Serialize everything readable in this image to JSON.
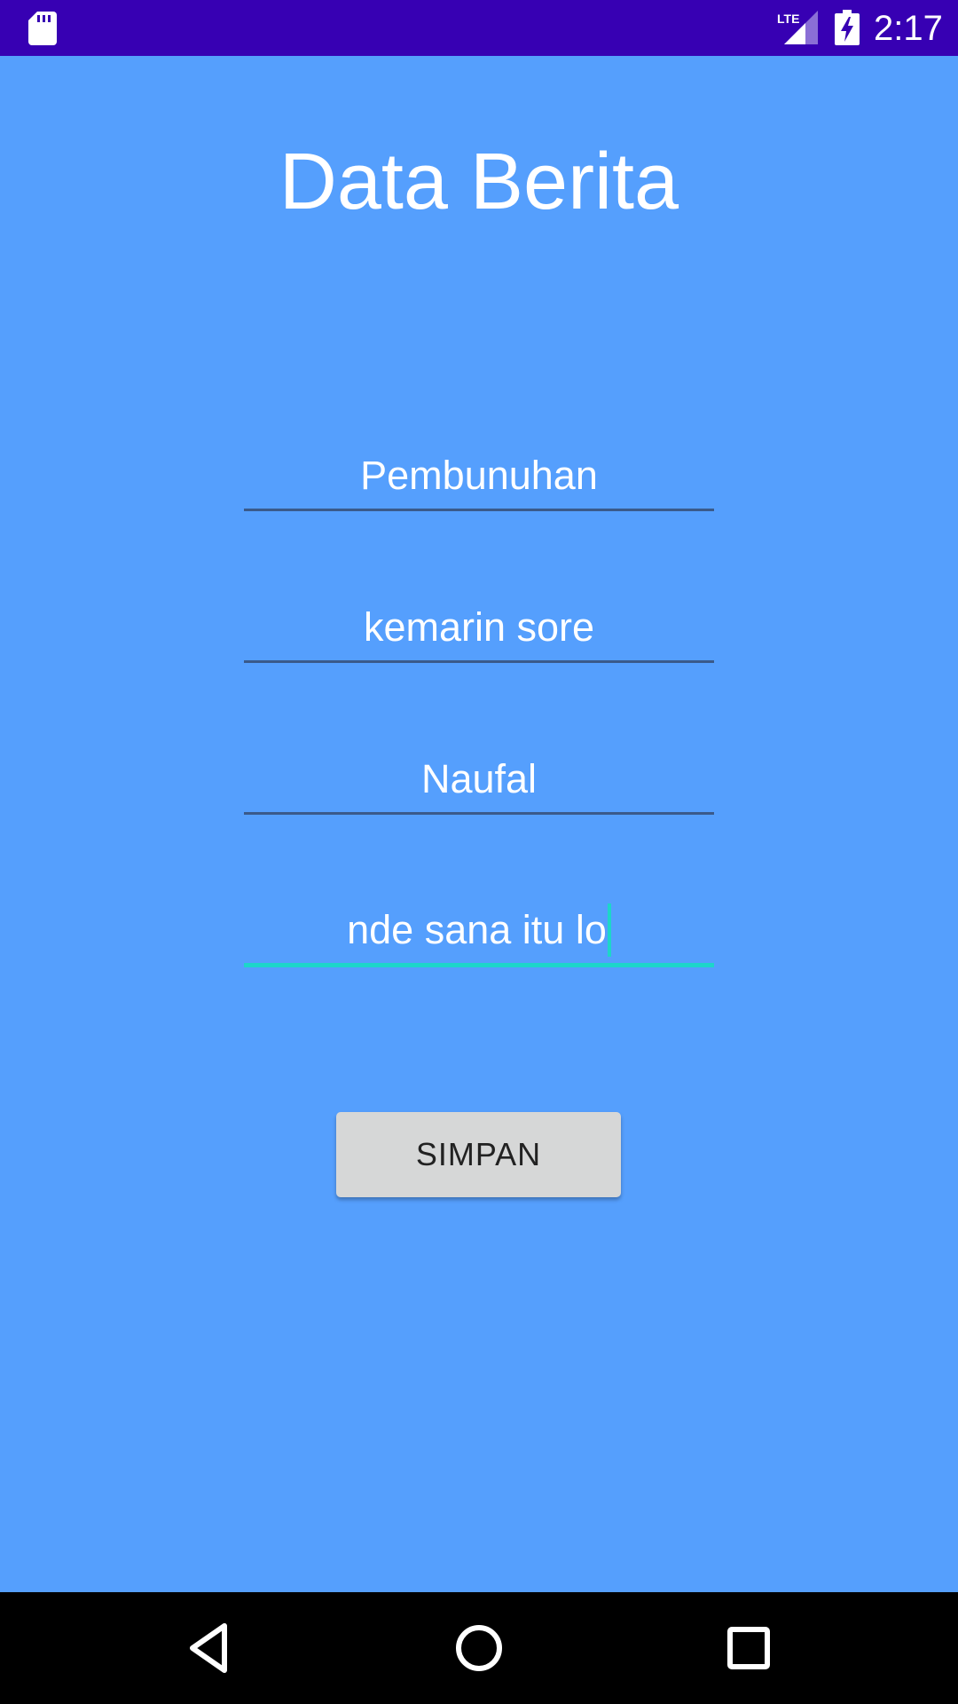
{
  "status_bar": {
    "time": "2:17",
    "network_label": "LTE",
    "icons": [
      "sd-card-icon",
      "lte-signal-icon",
      "battery-charging-icon"
    ],
    "background_color": "#3700B3"
  },
  "app": {
    "title": "Data Berita",
    "background_color": "#559FFD"
  },
  "form": {
    "fields": [
      {
        "value": "Pembunuhan",
        "focused": false
      },
      {
        "value": "kemarin sore",
        "focused": false
      },
      {
        "value": "Naufal",
        "focused": false
      },
      {
        "value": "nde sana itu lo",
        "focused": true
      }
    ],
    "accent_color": "#1DD6C9",
    "submit_label": "SIMPAN"
  },
  "nav_bar": {
    "icons": [
      "back-icon",
      "home-icon",
      "recents-icon"
    ]
  }
}
